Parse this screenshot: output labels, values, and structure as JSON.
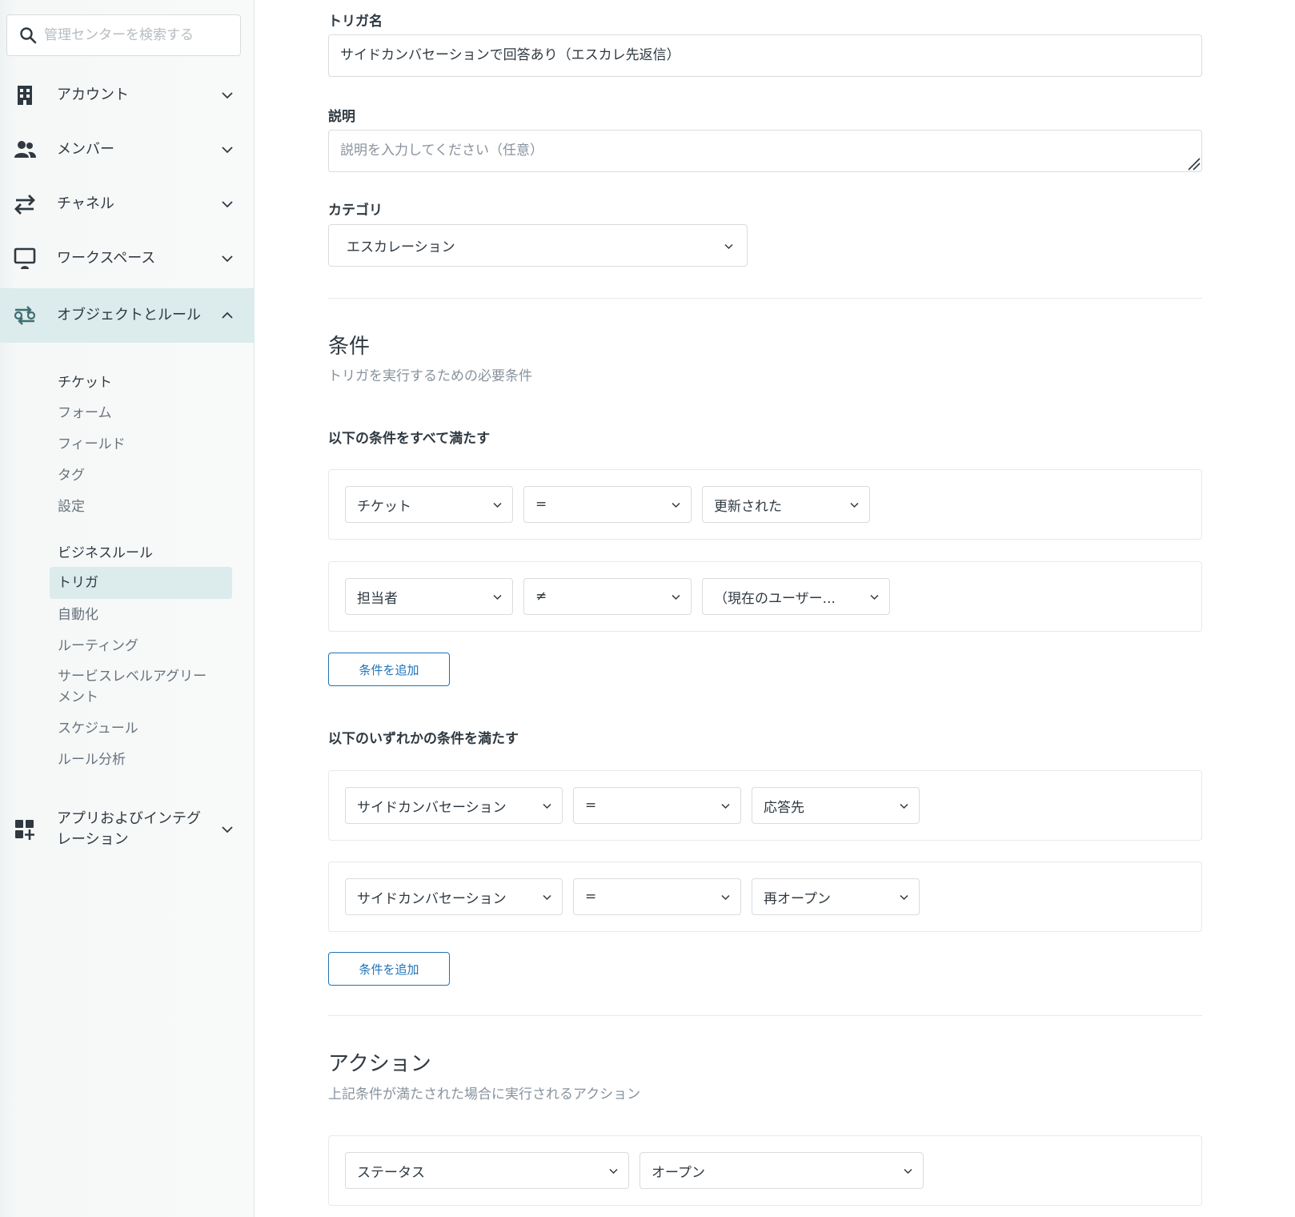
{
  "sidebar": {
    "search_placeholder": "管理センターを検索する",
    "nav": [
      {
        "label": "アカウント"
      },
      {
        "label": "メンバー"
      },
      {
        "label": "チャネル"
      },
      {
        "label": "ワークスペース"
      },
      {
        "label": "オブジェクトとルール"
      },
      {
        "label": "アプリおよびインテグ\nレーション"
      }
    ],
    "objects_submenu": [
      "チケット",
      "フォーム",
      "フィールド",
      "タグ",
      "設定"
    ],
    "rules_submenu": [
      "ビジネスルール",
      "トリガ",
      "自動化",
      "ルーティング",
      "サービスレベルアグリー\nメント",
      "スケジュール",
      "ルール分析"
    ]
  },
  "form": {
    "trigger_name_label": "トリガ名",
    "trigger_name_value": "サイドカンバセーションで回答あり（エスカレ先返信）",
    "description_label": "説明",
    "description_placeholder": "説明を入力してください（任意）",
    "category_label": "カテゴリ",
    "category_value": "エスカレーション"
  },
  "conditions": {
    "title": "条件",
    "subtitle": "トリガを実行するための必要条件",
    "all_title": "以下の条件をすべて満たす",
    "all_rows": [
      {
        "field": "チケット",
        "operator": "=",
        "value": "更新された"
      },
      {
        "field": "担当者",
        "operator": "≠",
        "value": "（現在のユーザー..."
      }
    ],
    "any_title": "以下のいずれかの条件を満たす",
    "any_rows": [
      {
        "field": "サイドカンバセーション",
        "operator": "=",
        "value": "応答先"
      },
      {
        "field": "サイドカンバセーション",
        "operator": "=",
        "value": "再オープン"
      }
    ],
    "add_label": "条件を追加"
  },
  "actions": {
    "title": "アクション",
    "subtitle": "上記条件が満たされた場合に実行されるアクション",
    "rows": [
      {
        "field": "ステータス",
        "value": "オープン"
      }
    ]
  },
  "icons": {
    "search": "search-icon",
    "account": "building-icon",
    "members": "people-icon",
    "channels": "arrows-exchange-icon",
    "workspace": "monitor-icon",
    "objects": "route-icon",
    "apps": "grid-plus-icon",
    "chevron": "chevron-icon"
  },
  "colors": {
    "accent": "#1f73b7",
    "active_bg": "#dcebeb",
    "text": "#2f3941",
    "muted": "#87929d"
  }
}
